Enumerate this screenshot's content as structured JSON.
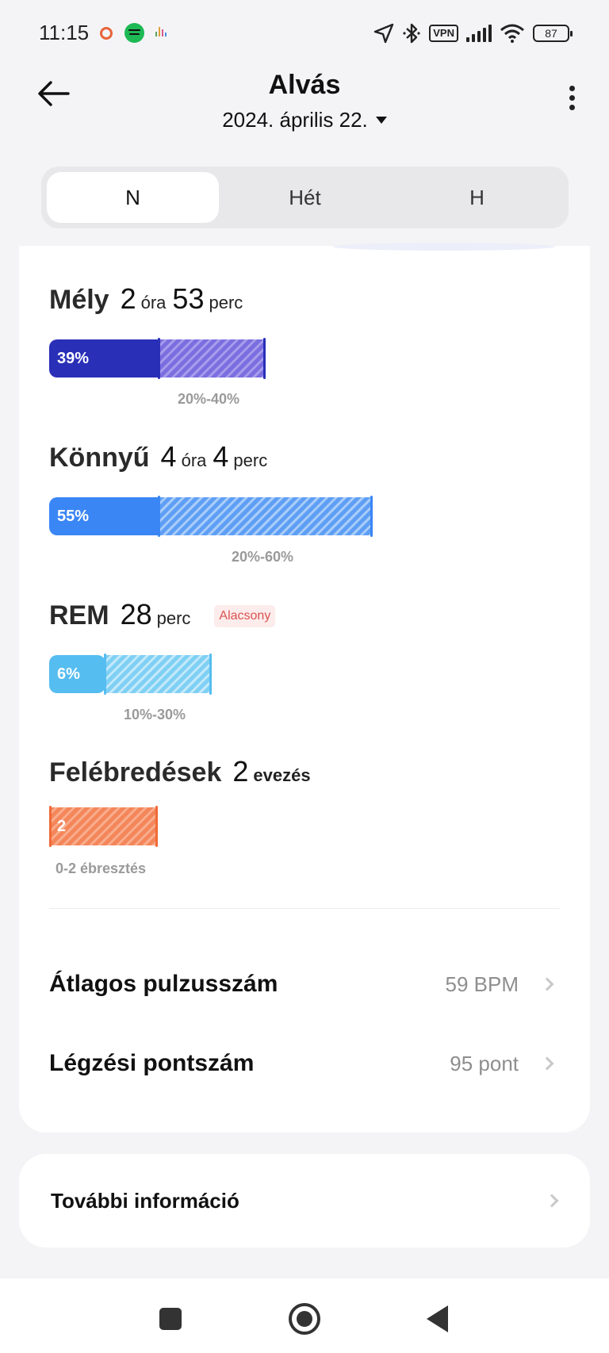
{
  "status_bar": {
    "time": "11:15",
    "vpn_label": "VPN",
    "battery": "87",
    "icons": [
      "notification-ring-icon",
      "spotify-icon",
      "podcast-icon",
      "location-icon",
      "bluetooth-icon",
      "vpn-icon",
      "signal-icon",
      "wifi-icon",
      "battery-icon"
    ]
  },
  "header": {
    "title": "Alvás",
    "date": "2024. április 22."
  },
  "tabs": [
    {
      "label": "N",
      "active": true
    },
    {
      "label": "Hét",
      "active": false
    },
    {
      "label": "H",
      "active": false
    }
  ],
  "stages": {
    "deep": {
      "name": "Mély",
      "hours": "2",
      "hours_unit": "óra",
      "minutes": "53",
      "minutes_unit": "perc",
      "percent_label": "39%",
      "percent": 39,
      "range": "20%-40%",
      "color": "#2a2fb8"
    },
    "light": {
      "name": "Könnyű",
      "hours": "4",
      "hours_unit": "óra",
      "minutes": "4",
      "minutes_unit": "perc",
      "percent_label": "55%",
      "percent": 55,
      "range": "20%-60%",
      "color": "#3a86f5"
    },
    "rem": {
      "name": "REM",
      "minutes": "28",
      "minutes_unit": "perc",
      "badge": "Alacsony",
      "percent_label": "6%",
      "percent": 6,
      "range": "10%-30%",
      "color": "#55bdf0"
    },
    "awake": {
      "name": "Felébredések",
      "count": "2",
      "count_unit": "evezés",
      "value_label": "2",
      "range": "0-2 ébresztés",
      "color": "#f4865a"
    }
  },
  "metrics": [
    {
      "label": "Átlagos pulzusszám",
      "value": "59 BPM"
    },
    {
      "label": "Légzési pontszám",
      "value": "95 pont"
    }
  ],
  "more_info": {
    "label": "További információ"
  }
}
